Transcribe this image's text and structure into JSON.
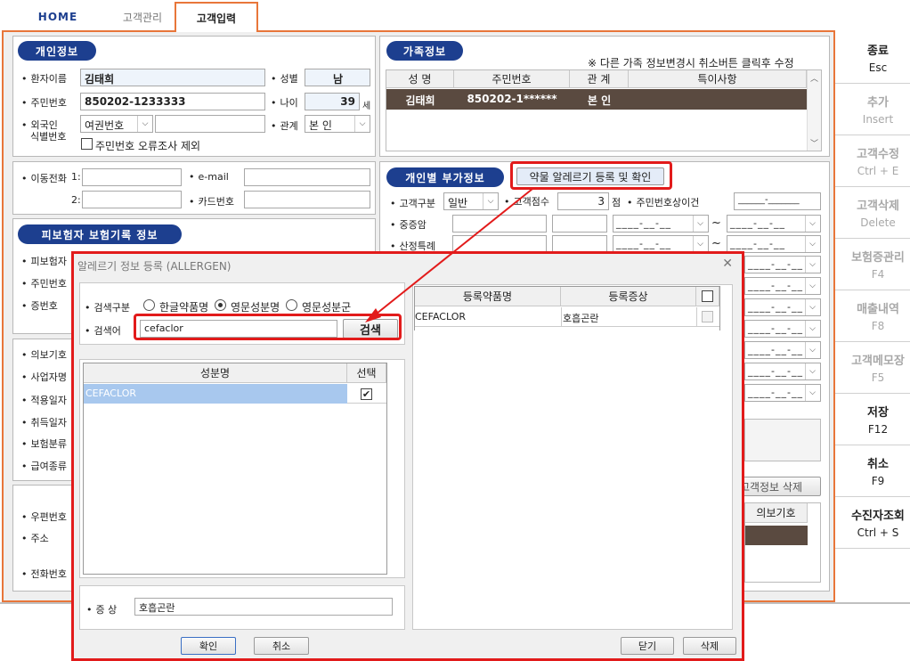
{
  "tabs": [
    "HOME",
    "고객관리",
    "고객입력"
  ],
  "personal": {
    "title": "개인정보",
    "name_label": "환자이름",
    "name": "김태희",
    "gender_label": "성별",
    "gender": "남",
    "rrn_label": "주민번호",
    "rrn": "850202-1233333",
    "age_label": "나이",
    "age": "39",
    "age_unit": "세",
    "foreign_label1": "외국인",
    "foreign_label2": "식별번호",
    "foreign_type": "여권번호",
    "relation_label": "관계",
    "relation": "본  인",
    "exclude_check": "주민번호 오류조사 제외"
  },
  "family": {
    "title": "가족정보",
    "note": "※ 다른 가족 정보변경시 취소버튼 클릭후 수정",
    "headers": [
      "성  명",
      "주민번호",
      "관  계",
      "특이사항"
    ],
    "row": [
      "김태희",
      "850202-1******",
      "본  인",
      ""
    ]
  },
  "contact": {
    "mobile_label": "이동전화",
    "mobile1": "1:",
    "mobile2": "2:",
    "email_label": "e-mail",
    "card_label": "카드번호"
  },
  "insurance": {
    "title": "피보험자 보험기록 정보",
    "labels": [
      "피보험자",
      "주민번호",
      "증번호"
    ],
    "labels2": [
      "의보기호",
      "사업자명",
      "적용일자",
      "취득일자",
      "보험분류",
      "급여종류"
    ],
    "labels3": [
      "우편번호",
      "주소",
      "전화번호"
    ]
  },
  "extra": {
    "title": "개인별 부가정보",
    "allergy_button": "약물 알레르기 등록 및 확인",
    "group_label": "고객구분",
    "group": "일반",
    "score_label": "고객점수",
    "score": "3",
    "score_unit": "점",
    "rrn_err_label": "주민번호상이건",
    "rrn_err": "______-_______",
    "rows": [
      "중증암",
      "산정특례"
    ],
    "date_placeholder": "____-__-__",
    "tilde": "~",
    "delete_btn": "고객정보 삭제",
    "insurance_col": "의보기호"
  },
  "right_buttons": [
    {
      "title": "종료",
      "key": "Esc",
      "enabled": true
    },
    {
      "title": "추가",
      "key": "Insert",
      "enabled": false
    },
    {
      "title": "고객수정",
      "key": "Ctrl + E",
      "enabled": false
    },
    {
      "title": "고객삭제",
      "key": "Delete",
      "enabled": false
    },
    {
      "title": "보험증관리",
      "key": "F4",
      "enabled": false
    },
    {
      "title": "매출내역",
      "key": "F8",
      "enabled": false
    },
    {
      "title": "고객메모장",
      "key": "F5",
      "enabled": false
    },
    {
      "title": "저장",
      "key": "F12",
      "enabled": true
    },
    {
      "title": "취소",
      "key": "F9",
      "enabled": true
    },
    {
      "title": "수진자조회",
      "key": "Ctrl + S",
      "enabled": true
    }
  ],
  "dialog": {
    "title": "알레르기 정보 등록 (ALLERGEN)",
    "close": "✕",
    "search_type_label": "검색구분",
    "radio": [
      "한글약품명",
      "영문성분명",
      "영문성분군"
    ],
    "keyword_label": "검색어",
    "keyword": "cefaclor",
    "search_btn": "검색",
    "ing_headers": [
      "성분명",
      "선택"
    ],
    "ing_rows": [
      {
        "name": "CEFACLOR",
        "checked": "✔"
      }
    ],
    "reg_headers": [
      "등록약품명",
      "등록증상"
    ],
    "reg_rows": [
      {
        "drug": "CEFACLOR",
        "symptom": "호흡곤란"
      }
    ],
    "symptom_label": "증  상",
    "symptom": "호흡곤란",
    "ok": "확인",
    "cancel": "취소",
    "close_btn": "닫기",
    "delete": "삭제"
  },
  "colors": {
    "accent": "#1d3f8f",
    "highlight": "#e21b1b",
    "tab_border": "#e8763a",
    "row_dark": "#5a4a40",
    "selected": "#a8c8ee"
  }
}
